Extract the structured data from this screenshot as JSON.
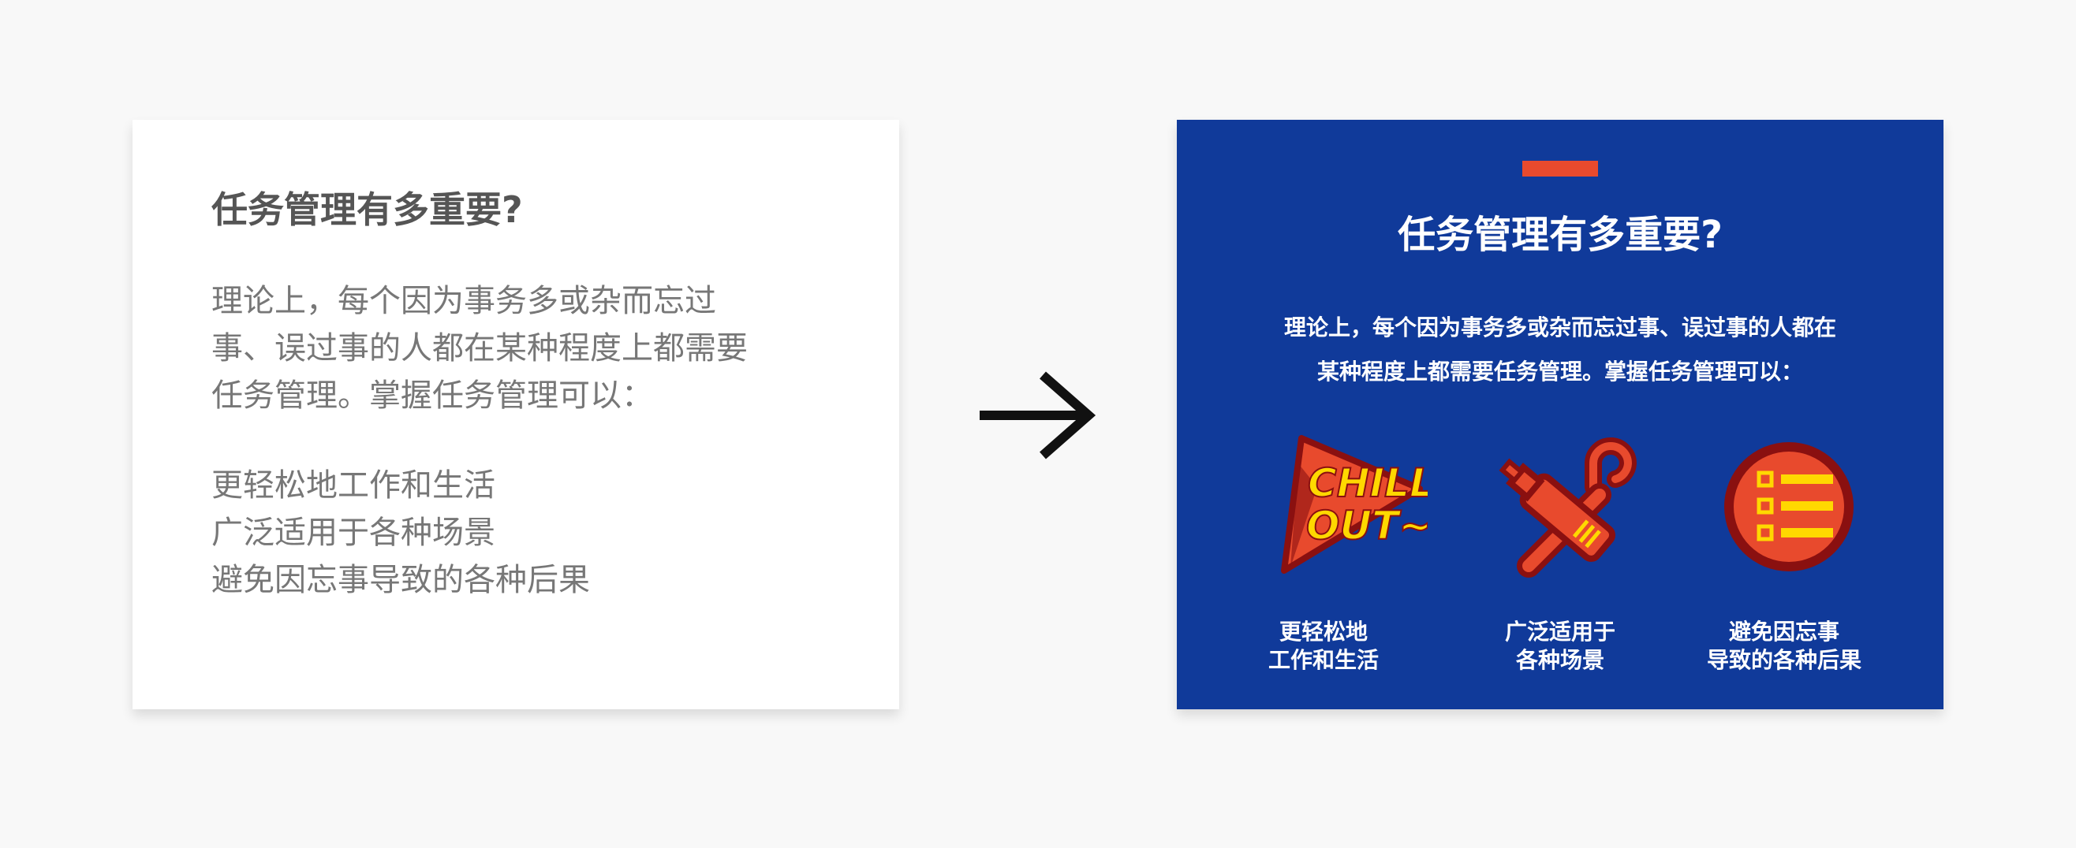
{
  "before": {
    "title": "任务管理有多重要?",
    "body_lines": [
      "理论上，每个因为事务多或杂而忘过",
      "事、误过事的人都在某种程度上都需要",
      "任务管理。掌握任务管理可以："
    ],
    "list": [
      "更轻松地工作和生活",
      "广泛适用于各种场景",
      "避免因忘事导致的各种后果"
    ]
  },
  "after": {
    "title": "任务管理有多重要?",
    "body_lines": [
      "理论上，每个因为事务多或杂而忘过事、误过事的人都在",
      "某种程度上都需要任务管理。掌握任务管理可以："
    ],
    "icon_chill_text": [
      "CHILL",
      "OUT~"
    ],
    "captions": [
      [
        "更轻松地",
        "工作和生活"
      ],
      [
        "广泛适用于",
        "各种场景"
      ],
      [
        "避免因忘事",
        "导致的各种后果"
      ]
    ]
  },
  "icons": {
    "arrow": "arrow-right-icon",
    "chill": "chill-out-pennant-icon",
    "flask": "flask-wrench-icon",
    "list": "checklist-icon"
  },
  "colors": {
    "background": "#f8f8f8",
    "after_bg": "#103a9a",
    "accent": "#e84a2d",
    "yellow": "#ffd800",
    "dark_red": "#8a1010"
  }
}
